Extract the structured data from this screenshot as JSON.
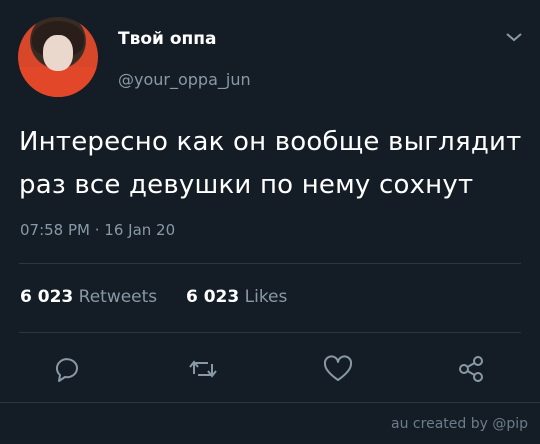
{
  "author": {
    "display_name": "Твой оппа",
    "handle": "@your_oppa_jun"
  },
  "tweet": {
    "text_line1": "Интересно как он вообще выглядит",
    "text_line2": "раз все девушки по нему сохнут",
    "timestamp": "07:58 PM · 16 Jan 20"
  },
  "stats": {
    "retweets_count": "6 023",
    "retweets_label": "Retweets",
    "likes_count": "6 023",
    "likes_label": "Likes"
  },
  "actions": {
    "icons": [
      "reply-icon",
      "retweet-icon",
      "like-icon",
      "share-icon"
    ]
  },
  "watermark": "au created by @pip",
  "colors": {
    "background": "#141d26",
    "text": "#ffffff",
    "muted": "#8899a6",
    "divider": "#2a3742"
  }
}
